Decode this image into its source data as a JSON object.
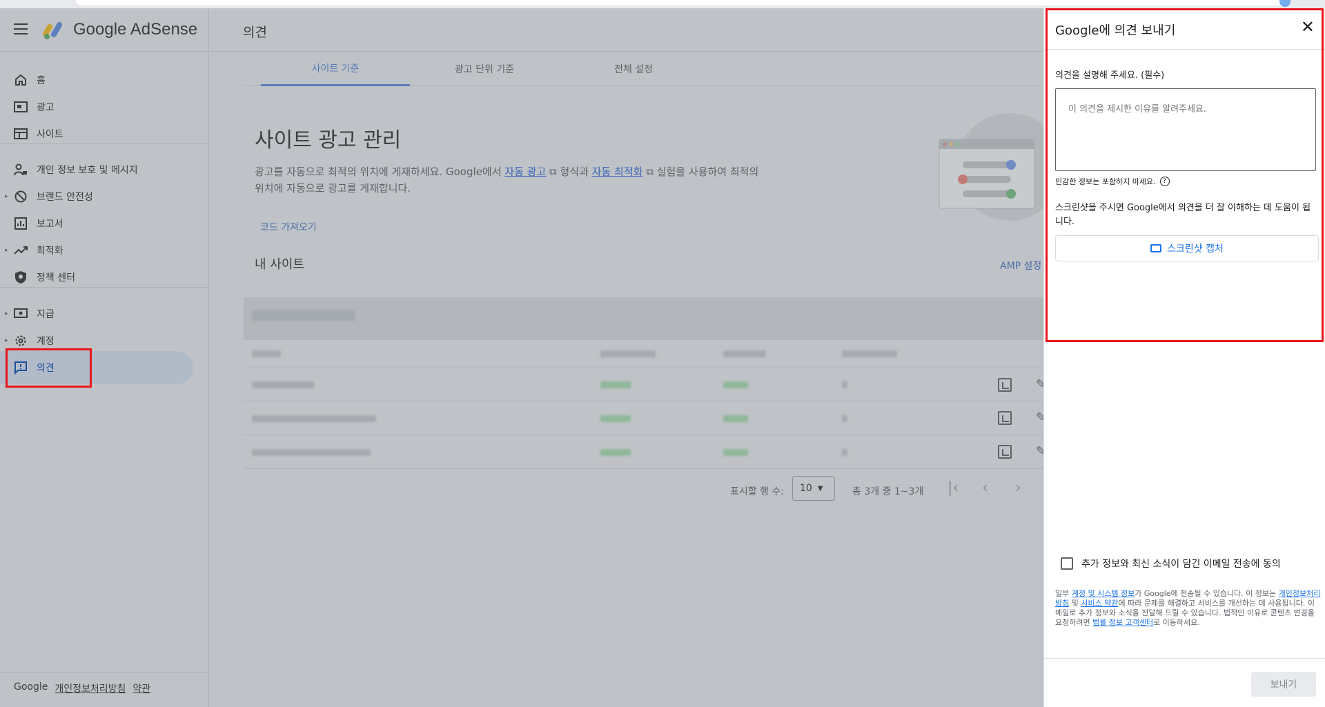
{
  "app": {
    "brand": "Google AdSense",
    "page_title": "의견"
  },
  "sidebar": {
    "items": [
      {
        "label": "홈",
        "icon": "home-icon"
      },
      {
        "label": "광고",
        "icon": "ads-icon"
      },
      {
        "label": "사이트",
        "icon": "sites-icon"
      },
      {
        "label": "개인 정보 보호 및 메시지",
        "icon": "privacy-icon"
      },
      {
        "label": "브랜드 안전성",
        "icon": "block-icon"
      },
      {
        "label": "보고서",
        "icon": "reports-icon"
      },
      {
        "label": "최적화",
        "icon": "trending-icon"
      },
      {
        "label": "정책 센터",
        "icon": "policy-icon"
      },
      {
        "label": "지급",
        "icon": "payments-icon"
      },
      {
        "label": "계정",
        "icon": "gear-icon"
      },
      {
        "label": "의견",
        "icon": "feedback-icon",
        "active": true
      }
    ],
    "footer": {
      "google": "Google",
      "privacy": "개인정보처리방침",
      "terms": "약관"
    }
  },
  "main": {
    "tabs": [
      {
        "label": "사이트 기준",
        "active": true
      },
      {
        "label": "광고 단위 기준"
      },
      {
        "label": "전체 설정"
      }
    ],
    "heading": "사이트 광고 관리",
    "desc_part1": "광고를 자동으로 최적의 위치에 게재하세요. Google에서 ",
    "desc_link1": "자동 광고",
    "desc_part2": " 형식과 ",
    "desc_link2": "자동 최적화",
    "desc_part3": " 실험을 사용하여 최적의 위치에 자동으로 광고를 게재합니다.",
    "get_code": "코드 가져오기",
    "my_sites": "내 사이트",
    "amp_link": "AMP 설정",
    "pager": {
      "rows_label": "표시할 행 수:",
      "rows_value": "10",
      "range": "총 3개 중 1~3개"
    }
  },
  "feedback": {
    "title_google": "Google",
    "title_rest": "에 의견 보내기",
    "describe_label": "의견을 설명해 주세요. (필수)",
    "textarea_placeholder": "이 의견을 제시한 이유를 알려주세요.",
    "sensitive_hint": "민감한 정보는 포함하지 마세요.",
    "screenshot_text": "스크린샷을 주시면 Google에서 의견을 더 잘 이해하는 데 도움이 됩니다.",
    "capture_button": "스크린샷 캡처",
    "consent_label": "추가 정보와 최신 소식이 담긴 이메일 전송에 동의",
    "legal": {
      "p1": "일부 ",
      "link1": "계정 및 시스템 정보",
      "p2": "가 Google에 전송될 수 있습니다. 이 정보는 ",
      "link2": "개인정보처리방침",
      "p3": " 및 ",
      "link3": "서비스 약관",
      "p4": "에 따라 문제를 해결하고 서비스를 개선하는 데 사용됩니다. 이메일로 추가 정보와 소식을 전달해 드릴 수 있습니다. 법적인 이유로 콘텐츠 변경을 요청하려면 ",
      "link4": "법률 정보 고객센터",
      "p5": "로 이동하세요."
    },
    "send_button": "보내기"
  },
  "colors": {
    "accent": "#1a73e8",
    "highlight": "#e8141b",
    "overlay": "#bfc3c7"
  }
}
